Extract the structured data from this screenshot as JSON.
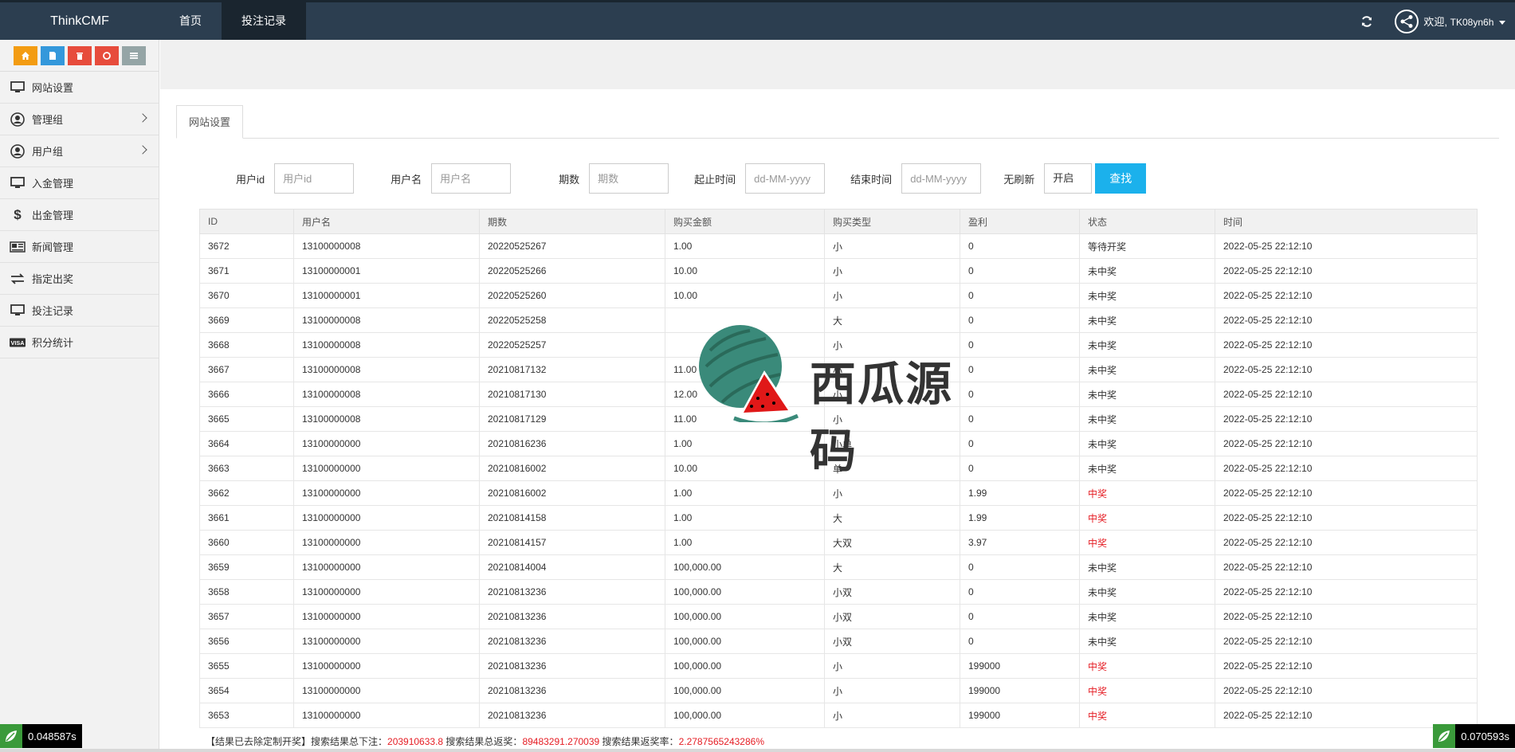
{
  "header": {
    "brand": "ThinkCMF",
    "nav": [
      {
        "label": "首页",
        "active": false
      },
      {
        "label": "投注记录",
        "active": true
      }
    ],
    "welcome": "欢迎,",
    "username": "TK08yn6h"
  },
  "sidebar": {
    "shortcuts": [
      {
        "icon": "home-icon",
        "color": "#f39c12"
      },
      {
        "icon": "document-icon",
        "color": "#3498db"
      },
      {
        "icon": "trash-icon",
        "color": "#e74c3c"
      },
      {
        "icon": "recycle-icon",
        "color": "#e74c3c"
      },
      {
        "icon": "list-icon",
        "color": "#95a5a6"
      }
    ],
    "items": [
      {
        "label": "网站设置",
        "icon": "monitor-icon",
        "submenu": false
      },
      {
        "label": "管理组",
        "icon": "user-circle-icon",
        "submenu": true
      },
      {
        "label": "用户组",
        "icon": "user-circle-icon",
        "submenu": true
      },
      {
        "label": "入金管理",
        "icon": "monitor-icon",
        "submenu": false
      },
      {
        "label": "出金管理",
        "icon": "dollar-icon",
        "submenu": false
      },
      {
        "label": "新闻管理",
        "icon": "newspaper-icon",
        "submenu": false
      },
      {
        "label": "指定出奖",
        "icon": "exchange-icon",
        "submenu": false
      },
      {
        "label": "投注记录",
        "icon": "monitor-icon",
        "submenu": false
      },
      {
        "label": "积分统计",
        "icon": "visa-icon",
        "submenu": false
      }
    ]
  },
  "tab": {
    "label": "网站设置"
  },
  "filters": {
    "user_id": {
      "label": "用户id",
      "placeholder": "用户id"
    },
    "username": {
      "label": "用户名",
      "placeholder": "用户名"
    },
    "period": {
      "label": "期数",
      "placeholder": "期数"
    },
    "start_time": {
      "label": "起止时间",
      "placeholder": "dd-MM-yyyy"
    },
    "end_time": {
      "label": "结束时间",
      "placeholder": "dd-MM-yyyy"
    },
    "no_refresh": {
      "label": "无刷新",
      "value": "开启"
    },
    "search_button": "查找"
  },
  "table": {
    "columns": [
      "ID",
      "用户名",
      "期数",
      "购买金额",
      "购买类型",
      "盈利",
      "状态",
      "时间"
    ],
    "rows": [
      [
        "3672",
        "13100000008",
        "20220525267",
        "1.00",
        "小",
        "0",
        "等待开奖",
        "2022-05-25 22:12:10"
      ],
      [
        "3671",
        "13100000001",
        "20220525266",
        "10.00",
        "小",
        "0",
        "未中奖",
        "2022-05-25 22:12:10"
      ],
      [
        "3670",
        "13100000001",
        "20220525260",
        "10.00",
        "小",
        "0",
        "未中奖",
        "2022-05-25 22:12:10"
      ],
      [
        "3669",
        "13100000008",
        "20220525258",
        "",
        "大",
        "0",
        "未中奖",
        "2022-05-25 22:12:10"
      ],
      [
        "3668",
        "13100000008",
        "20220525257",
        "",
        "小",
        "0",
        "未中奖",
        "2022-05-25 22:12:10"
      ],
      [
        "3667",
        "13100000008",
        "20210817132",
        "11.00",
        "小",
        "0",
        "未中奖",
        "2022-05-25 22:12:10"
      ],
      [
        "3666",
        "13100000008",
        "20210817130",
        "12.00",
        "小",
        "0",
        "未中奖",
        "2022-05-25 22:12:10"
      ],
      [
        "3665",
        "13100000008",
        "20210817129",
        "11.00",
        "小",
        "0",
        "未中奖",
        "2022-05-25 22:12:10"
      ],
      [
        "3664",
        "13100000000",
        "20210816236",
        "1.00",
        "小单",
        "0",
        "未中奖",
        "2022-05-25 22:12:10"
      ],
      [
        "3663",
        "13100000000",
        "20210816002",
        "10.00",
        "单",
        "0",
        "未中奖",
        "2022-05-25 22:12:10"
      ],
      [
        "3662",
        "13100000000",
        "20210816002",
        "1.00",
        "小",
        "1.99",
        "中奖",
        "2022-05-25 22:12:10"
      ],
      [
        "3661",
        "13100000000",
        "20210814158",
        "1.00",
        "大",
        "1.99",
        "中奖",
        "2022-05-25 22:12:10"
      ],
      [
        "3660",
        "13100000000",
        "20210814157",
        "1.00",
        "大双",
        "3.97",
        "中奖",
        "2022-05-25 22:12:10"
      ],
      [
        "3659",
        "13100000000",
        "20210814004",
        "100,000.00",
        "大",
        "0",
        "未中奖",
        "2022-05-25 22:12:10"
      ],
      [
        "3658",
        "13100000000",
        "20210813236",
        "100,000.00",
        "小双",
        "0",
        "未中奖",
        "2022-05-25 22:12:10"
      ],
      [
        "3657",
        "13100000000",
        "20210813236",
        "100,000.00",
        "小双",
        "0",
        "未中奖",
        "2022-05-25 22:12:10"
      ],
      [
        "3656",
        "13100000000",
        "20210813236",
        "100,000.00",
        "小双",
        "0",
        "未中奖",
        "2022-05-25 22:12:10"
      ],
      [
        "3655",
        "13100000000",
        "20210813236",
        "100,000.00",
        "小",
        "199000",
        "中奖",
        "2022-05-25 22:12:10"
      ],
      [
        "3654",
        "13100000000",
        "20210813236",
        "100,000.00",
        "小",
        "199000",
        "中奖",
        "2022-05-25 22:12:10"
      ],
      [
        "3653",
        "13100000000",
        "20210813236",
        "100,000.00",
        "小",
        "199000",
        "中奖",
        "2022-05-25 22:12:10"
      ]
    ],
    "win_status": "中奖",
    "win_color": "#e51c23"
  },
  "summary": {
    "prefix": "【结果已去除定制开奖】搜索结果总下注：",
    "total_bet": "203910633.8",
    "mid1": " 搜索结果总返奖：",
    "total_return": "89483291.270039",
    "mid2": " 搜索结果返奖率：",
    "return_rate": "2.2787565243286%"
  },
  "timers": {
    "left": "0.048587s",
    "right": "0.070593s"
  },
  "watermark": {
    "text": "西瓜源码"
  }
}
